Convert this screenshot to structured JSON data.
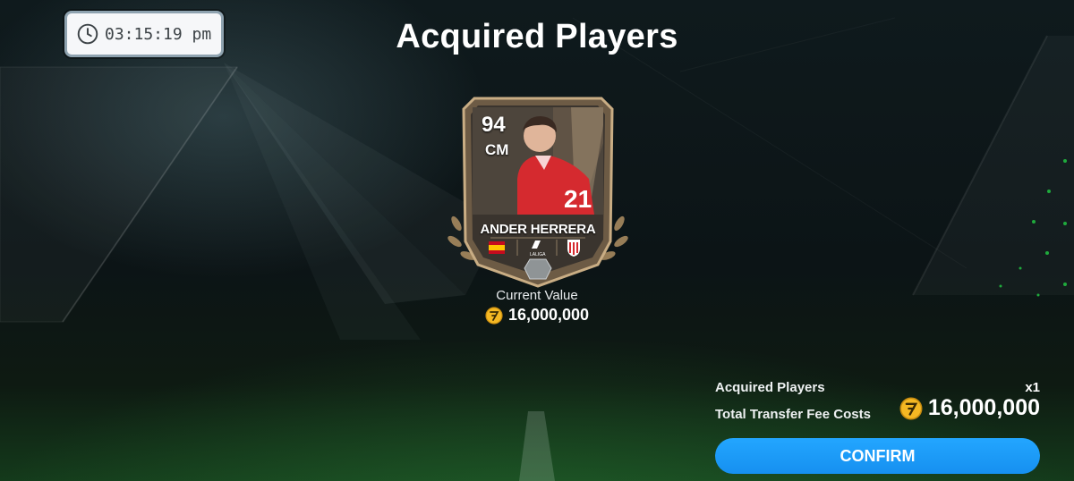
{
  "header": {
    "clock_time": "03:15:19 pm",
    "title": "Acquired Players"
  },
  "player_card": {
    "rating": "94",
    "position": "CM",
    "name": "ANDER HERRERA",
    "league_label": "LALIGA"
  },
  "current_value": {
    "label": "Current Value",
    "amount": "16,000,000"
  },
  "summary": {
    "acquired_label": "Acquired Players",
    "acquired_count": "x1",
    "fee_label": "Total Transfer Fee Costs",
    "fee_amount": "16,000,000"
  },
  "actions": {
    "confirm_label": "CONFIRM"
  },
  "colors": {
    "accent_button": "#1a98f5",
    "coin_gold": "#f5b823",
    "card_bronze": "#8c7457"
  },
  "icons": [
    "clock-icon",
    "coin-icon",
    "spain-flag-icon",
    "laliga-icon",
    "club-crest-icon",
    "card-tier-icon"
  ]
}
